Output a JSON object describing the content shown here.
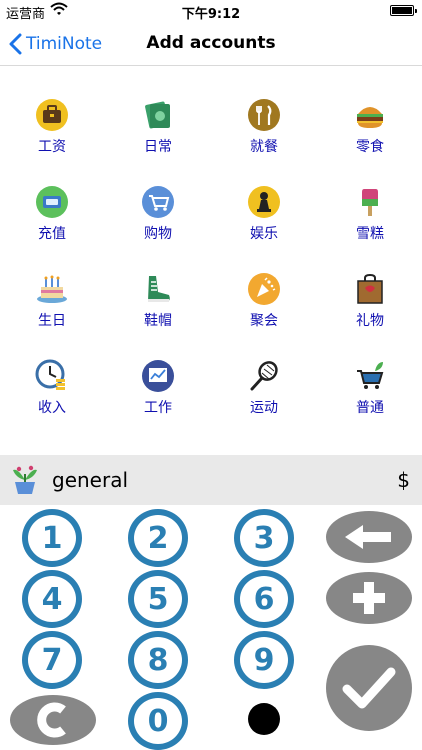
{
  "status_bar": {
    "carrier": "运营商",
    "time": "下午9:12"
  },
  "nav": {
    "back_label": "TimiNote",
    "title": "Add accounts"
  },
  "categories": [
    {
      "label": "工资",
      "icon": "briefcase-icon"
    },
    {
      "label": "日常",
      "icon": "money-bills-icon"
    },
    {
      "label": "就餐",
      "icon": "fork-knife-icon"
    },
    {
      "label": "零食",
      "icon": "burger-icon"
    },
    {
      "label": "充值",
      "icon": "recharge-card-icon"
    },
    {
      "label": "购物",
      "icon": "shopping-cart-icon"
    },
    {
      "label": "娱乐",
      "icon": "chess-pawn-icon"
    },
    {
      "label": "雪糕",
      "icon": "popsicle-icon"
    },
    {
      "label": "生日",
      "icon": "birthday-cake-icon"
    },
    {
      "label": "鞋帽",
      "icon": "sneaker-icon"
    },
    {
      "label": "聚会",
      "icon": "party-popper-icon"
    },
    {
      "label": "礼物",
      "icon": "gift-bag-icon"
    },
    {
      "label": "收入",
      "icon": "clock-coins-icon"
    },
    {
      "label": "工作",
      "icon": "chart-board-icon"
    },
    {
      "label": "运动",
      "icon": "tennis-racket-icon"
    },
    {
      "label": "普通",
      "icon": "cart-plant-icon"
    }
  ],
  "account": {
    "name": "general",
    "currency": "$",
    "icon": "plant-pot-icon"
  },
  "keypad": {
    "digits": [
      "1",
      "2",
      "3",
      "4",
      "5",
      "6",
      "7",
      "8",
      "9",
      "0"
    ],
    "keys": [
      "backspace",
      "plus",
      "clear",
      "decimal-point",
      "confirm"
    ]
  },
  "colors": {
    "accent": "#1a73e8",
    "label": "#1010b0",
    "keypad_ring": "#2a7fb3",
    "gray_key": "#878787",
    "account_bar": "#e9e9e9"
  }
}
